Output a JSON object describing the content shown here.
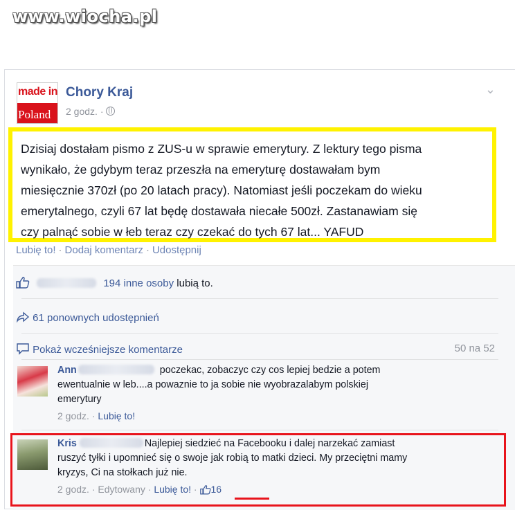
{
  "watermark": "www.wiocha.pl",
  "post": {
    "logo_top": "made in",
    "logo_bottom": "Poland",
    "page_name": "Chory Kraj",
    "time": "2 godz. ·",
    "text_lines": [
      "Dzisiaj dostałam pismo z ZUS-u w sprawie emerytury. Z lektury tego pisma",
      "wynikało, że gdybym teraz przeszła na emeryturę dostawałam bym",
      "miesięcznie 370zł (po 20 latach pracy). Natomiast jeśli poczekam do wieku",
      "emerytalnego, czyli 67 lat będę dostawała niecałe 500zł. Zastanawiam się",
      "czy palnąć sobie w łeb teraz czy czekać do tych 67 lat... YAFUD"
    ],
    "actions": {
      "like": "Lubię to!",
      "comment": "Dodaj komentarz",
      "share": "Udostępnij",
      "sep": "·"
    }
  },
  "likes": {
    "others": "194 inne osoby",
    "suffix": "lubią to."
  },
  "shares": {
    "text": "61 ponownych udostępnień"
  },
  "comments_header": {
    "show_more": "Pokaż wcześniejsze komentarze",
    "count": "50 na 52"
  },
  "comments": [
    {
      "author": "Ann",
      "text_lines": [
        "poczekac, zobaczyc czy cos lepiej bedzie a potem",
        "ewentualnie w leb....a powaznie to ja sobie nie wyobrazalabym polskiej",
        "emerytury"
      ],
      "time": "2 godz.",
      "like": "Lubię to!"
    },
    {
      "author": "Kris",
      "text_lines": [
        "Najlepiej siedzieć na Facebooku i dalej narzekać zamiast",
        "ruszyć tyłki i upomnieć się o swoje jak robią to matki dzieci. My przeciętni mamy",
        "kryzys, Ci na stołkach już nie."
      ],
      "time": "2 godz.",
      "edited": "Edytowany",
      "like": "Lubię to!",
      "like_count": "16"
    }
  ],
  "colors": {
    "fb_blue": "#3b5998",
    "highlight_yellow": "#fff200",
    "annotation_red": "#e8141c",
    "muted": "#90949c"
  }
}
